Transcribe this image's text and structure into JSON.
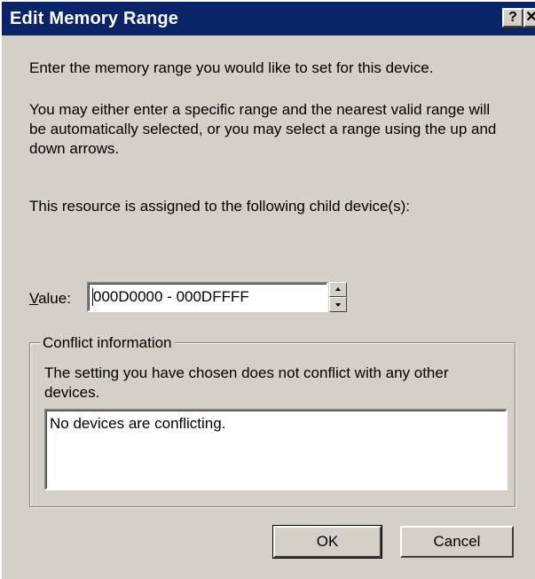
{
  "window": {
    "title": "Edit Memory Range",
    "help_button": "?",
    "close_button": "✕"
  },
  "body": {
    "instruction": "Enter the memory range you would like to set for this device.",
    "explanation": "You may either enter a specific range and the nearest valid range will be automatically selected, or you may select a range using the up and down arrows.",
    "assigned_text": "This resource is assigned to the following child device(s):"
  },
  "value": {
    "label_accel": "V",
    "label_rest": "alue:",
    "current": "000D0000 - 000DFFFF"
  },
  "conflict": {
    "group_label": "Conflict information",
    "description": "The setting you have chosen does not conflict with any other devices.",
    "list_text": "No devices are conflicting."
  },
  "buttons": {
    "ok": "OK",
    "cancel": "Cancel"
  }
}
